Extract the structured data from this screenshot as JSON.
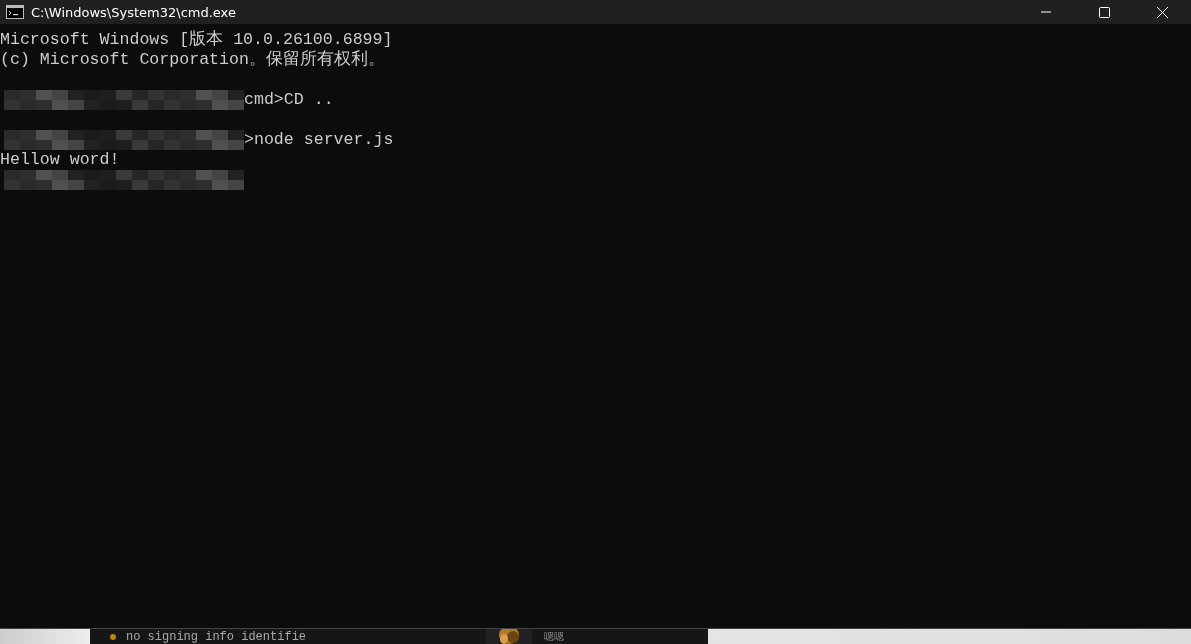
{
  "window": {
    "title": "C:\\Windows\\System32\\cmd.exe"
  },
  "console": {
    "lines": [
      {
        "kind": "text",
        "text": "Microsoft Windows [版本 10.0.26100.6899]"
      },
      {
        "kind": "text",
        "text": "(c) Microsoft Corporation。保留所有权利。"
      },
      {
        "kind": "blank"
      },
      {
        "kind": "redacted",
        "text": "cmd>CD .."
      },
      {
        "kind": "blank"
      },
      {
        "kind": "redacted",
        "text": ">node server.js"
      },
      {
        "kind": "text",
        "text": "Hellow word!"
      },
      {
        "kind": "redacted"
      }
    ]
  },
  "background": {
    "text": "no signing info identifie",
    "label": "嗯嗯"
  }
}
